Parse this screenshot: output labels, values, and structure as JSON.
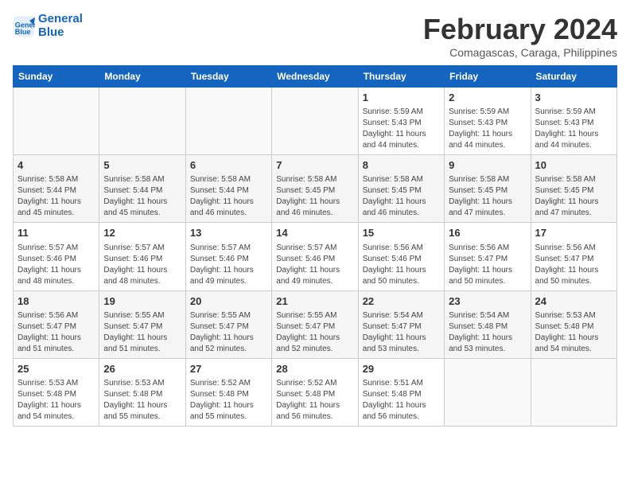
{
  "header": {
    "logo_line1": "General",
    "logo_line2": "Blue",
    "title": "February 2024",
    "subtitle": "Comagascas, Caraga, Philippines"
  },
  "days_of_week": [
    "Sunday",
    "Monday",
    "Tuesday",
    "Wednesday",
    "Thursday",
    "Friday",
    "Saturday"
  ],
  "weeks": [
    [
      {
        "day": "",
        "info": ""
      },
      {
        "day": "",
        "info": ""
      },
      {
        "day": "",
        "info": ""
      },
      {
        "day": "",
        "info": ""
      },
      {
        "day": "1",
        "info": "Sunrise: 5:59 AM\nSunset: 5:43 PM\nDaylight: 11 hours\nand 44 minutes."
      },
      {
        "day": "2",
        "info": "Sunrise: 5:59 AM\nSunset: 5:43 PM\nDaylight: 11 hours\nand 44 minutes."
      },
      {
        "day": "3",
        "info": "Sunrise: 5:59 AM\nSunset: 5:43 PM\nDaylight: 11 hours\nand 44 minutes."
      }
    ],
    [
      {
        "day": "4",
        "info": "Sunrise: 5:58 AM\nSunset: 5:44 PM\nDaylight: 11 hours\nand 45 minutes."
      },
      {
        "day": "5",
        "info": "Sunrise: 5:58 AM\nSunset: 5:44 PM\nDaylight: 11 hours\nand 45 minutes."
      },
      {
        "day": "6",
        "info": "Sunrise: 5:58 AM\nSunset: 5:44 PM\nDaylight: 11 hours\nand 46 minutes."
      },
      {
        "day": "7",
        "info": "Sunrise: 5:58 AM\nSunset: 5:45 PM\nDaylight: 11 hours\nand 46 minutes."
      },
      {
        "day": "8",
        "info": "Sunrise: 5:58 AM\nSunset: 5:45 PM\nDaylight: 11 hours\nand 46 minutes."
      },
      {
        "day": "9",
        "info": "Sunrise: 5:58 AM\nSunset: 5:45 PM\nDaylight: 11 hours\nand 47 minutes."
      },
      {
        "day": "10",
        "info": "Sunrise: 5:58 AM\nSunset: 5:45 PM\nDaylight: 11 hours\nand 47 minutes."
      }
    ],
    [
      {
        "day": "11",
        "info": "Sunrise: 5:57 AM\nSunset: 5:46 PM\nDaylight: 11 hours\nand 48 minutes."
      },
      {
        "day": "12",
        "info": "Sunrise: 5:57 AM\nSunset: 5:46 PM\nDaylight: 11 hours\nand 48 minutes."
      },
      {
        "day": "13",
        "info": "Sunrise: 5:57 AM\nSunset: 5:46 PM\nDaylight: 11 hours\nand 49 minutes."
      },
      {
        "day": "14",
        "info": "Sunrise: 5:57 AM\nSunset: 5:46 PM\nDaylight: 11 hours\nand 49 minutes."
      },
      {
        "day": "15",
        "info": "Sunrise: 5:56 AM\nSunset: 5:46 PM\nDaylight: 11 hours\nand 50 minutes."
      },
      {
        "day": "16",
        "info": "Sunrise: 5:56 AM\nSunset: 5:47 PM\nDaylight: 11 hours\nand 50 minutes."
      },
      {
        "day": "17",
        "info": "Sunrise: 5:56 AM\nSunset: 5:47 PM\nDaylight: 11 hours\nand 50 minutes."
      }
    ],
    [
      {
        "day": "18",
        "info": "Sunrise: 5:56 AM\nSunset: 5:47 PM\nDaylight: 11 hours\nand 51 minutes."
      },
      {
        "day": "19",
        "info": "Sunrise: 5:55 AM\nSunset: 5:47 PM\nDaylight: 11 hours\nand 51 minutes."
      },
      {
        "day": "20",
        "info": "Sunrise: 5:55 AM\nSunset: 5:47 PM\nDaylight: 11 hours\nand 52 minutes."
      },
      {
        "day": "21",
        "info": "Sunrise: 5:55 AM\nSunset: 5:47 PM\nDaylight: 11 hours\nand 52 minutes."
      },
      {
        "day": "22",
        "info": "Sunrise: 5:54 AM\nSunset: 5:47 PM\nDaylight: 11 hours\nand 53 minutes."
      },
      {
        "day": "23",
        "info": "Sunrise: 5:54 AM\nSunset: 5:48 PM\nDaylight: 11 hours\nand 53 minutes."
      },
      {
        "day": "24",
        "info": "Sunrise: 5:53 AM\nSunset: 5:48 PM\nDaylight: 11 hours\nand 54 minutes."
      }
    ],
    [
      {
        "day": "25",
        "info": "Sunrise: 5:53 AM\nSunset: 5:48 PM\nDaylight: 11 hours\nand 54 minutes."
      },
      {
        "day": "26",
        "info": "Sunrise: 5:53 AM\nSunset: 5:48 PM\nDaylight: 11 hours\nand 55 minutes."
      },
      {
        "day": "27",
        "info": "Sunrise: 5:52 AM\nSunset: 5:48 PM\nDaylight: 11 hours\nand 55 minutes."
      },
      {
        "day": "28",
        "info": "Sunrise: 5:52 AM\nSunset: 5:48 PM\nDaylight: 11 hours\nand 56 minutes."
      },
      {
        "day": "29",
        "info": "Sunrise: 5:51 AM\nSunset: 5:48 PM\nDaylight: 11 hours\nand 56 minutes."
      },
      {
        "day": "",
        "info": ""
      },
      {
        "day": "",
        "info": ""
      }
    ]
  ]
}
